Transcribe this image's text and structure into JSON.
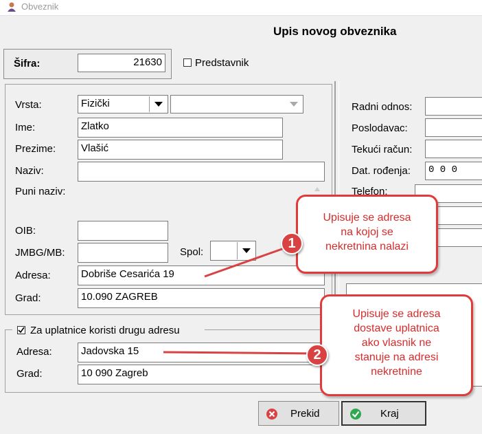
{
  "window": {
    "title": "Obveznik",
    "heading": "Upis novog obveznika"
  },
  "top": {
    "sifra_label": "Šifra:",
    "sifra_value": "21630",
    "predstavnik_label": "Predstavnik",
    "predstavnik_checked": false
  },
  "left": {
    "vrsta_label": "Vrsta:",
    "vrsta_value": "Fizički",
    "vrsta2_value": "",
    "ime_label": "Ime:",
    "ime_value": "Zlatko",
    "prezime_label": "Prezime:",
    "prezime_value": "Vlašić",
    "naziv_label": "Naziv:",
    "naziv_value": "",
    "puni_naziv_label": "Puni naziv:",
    "oib_label": "OIB:",
    "oib_value": "",
    "jmbg_label": "JMBG/MB:",
    "jmbg_value": "",
    "spol_label": "Spol:",
    "spol_value": "",
    "adresa_label": "Adresa:",
    "adresa_value": "Dobriše Cesarića 19",
    "grad_label": "Grad:",
    "grad_value": "10.090 ZAGREB"
  },
  "alt_address": {
    "checkbox_label": "Za uplatnice koristi drugu adresu",
    "checked": true,
    "adresa_label": "Adresa:",
    "adresa_value": "Jadovska 15",
    "grad_label": "Grad:",
    "grad_value": "10 090 Zagreb"
  },
  "right": {
    "radni_odnos_label": "Radni odnos:",
    "radni_odnos_value": "",
    "poslodavac_label": "Poslodavac:",
    "poslodavac_value": "",
    "tekuci_label": "Tekući račun:",
    "tekuci_value": "",
    "dat_rodenja_label": "Dat. rođenja:",
    "dat_rodenja_value": "0 0 0",
    "telefon_label": "Telefon:"
  },
  "buttons": {
    "prekid": "Prekid",
    "kraj": "Kraj"
  },
  "callouts": {
    "c1_number": "1",
    "c1_text": [
      "Upisuje se adresa",
      "na kojoj se",
      "nekretnina nalazi"
    ],
    "c2_number": "2",
    "c2_text": [
      "Upisuje se adresa",
      "dostave uplatnica",
      "ako vlasnik ne",
      "stanuje na adresi",
      "nekretnine"
    ]
  },
  "colors": {
    "callout_border": "#e03a3a",
    "callout_text": "#d62b2b",
    "badge": "#d94242",
    "background": "#f0f0f0"
  }
}
